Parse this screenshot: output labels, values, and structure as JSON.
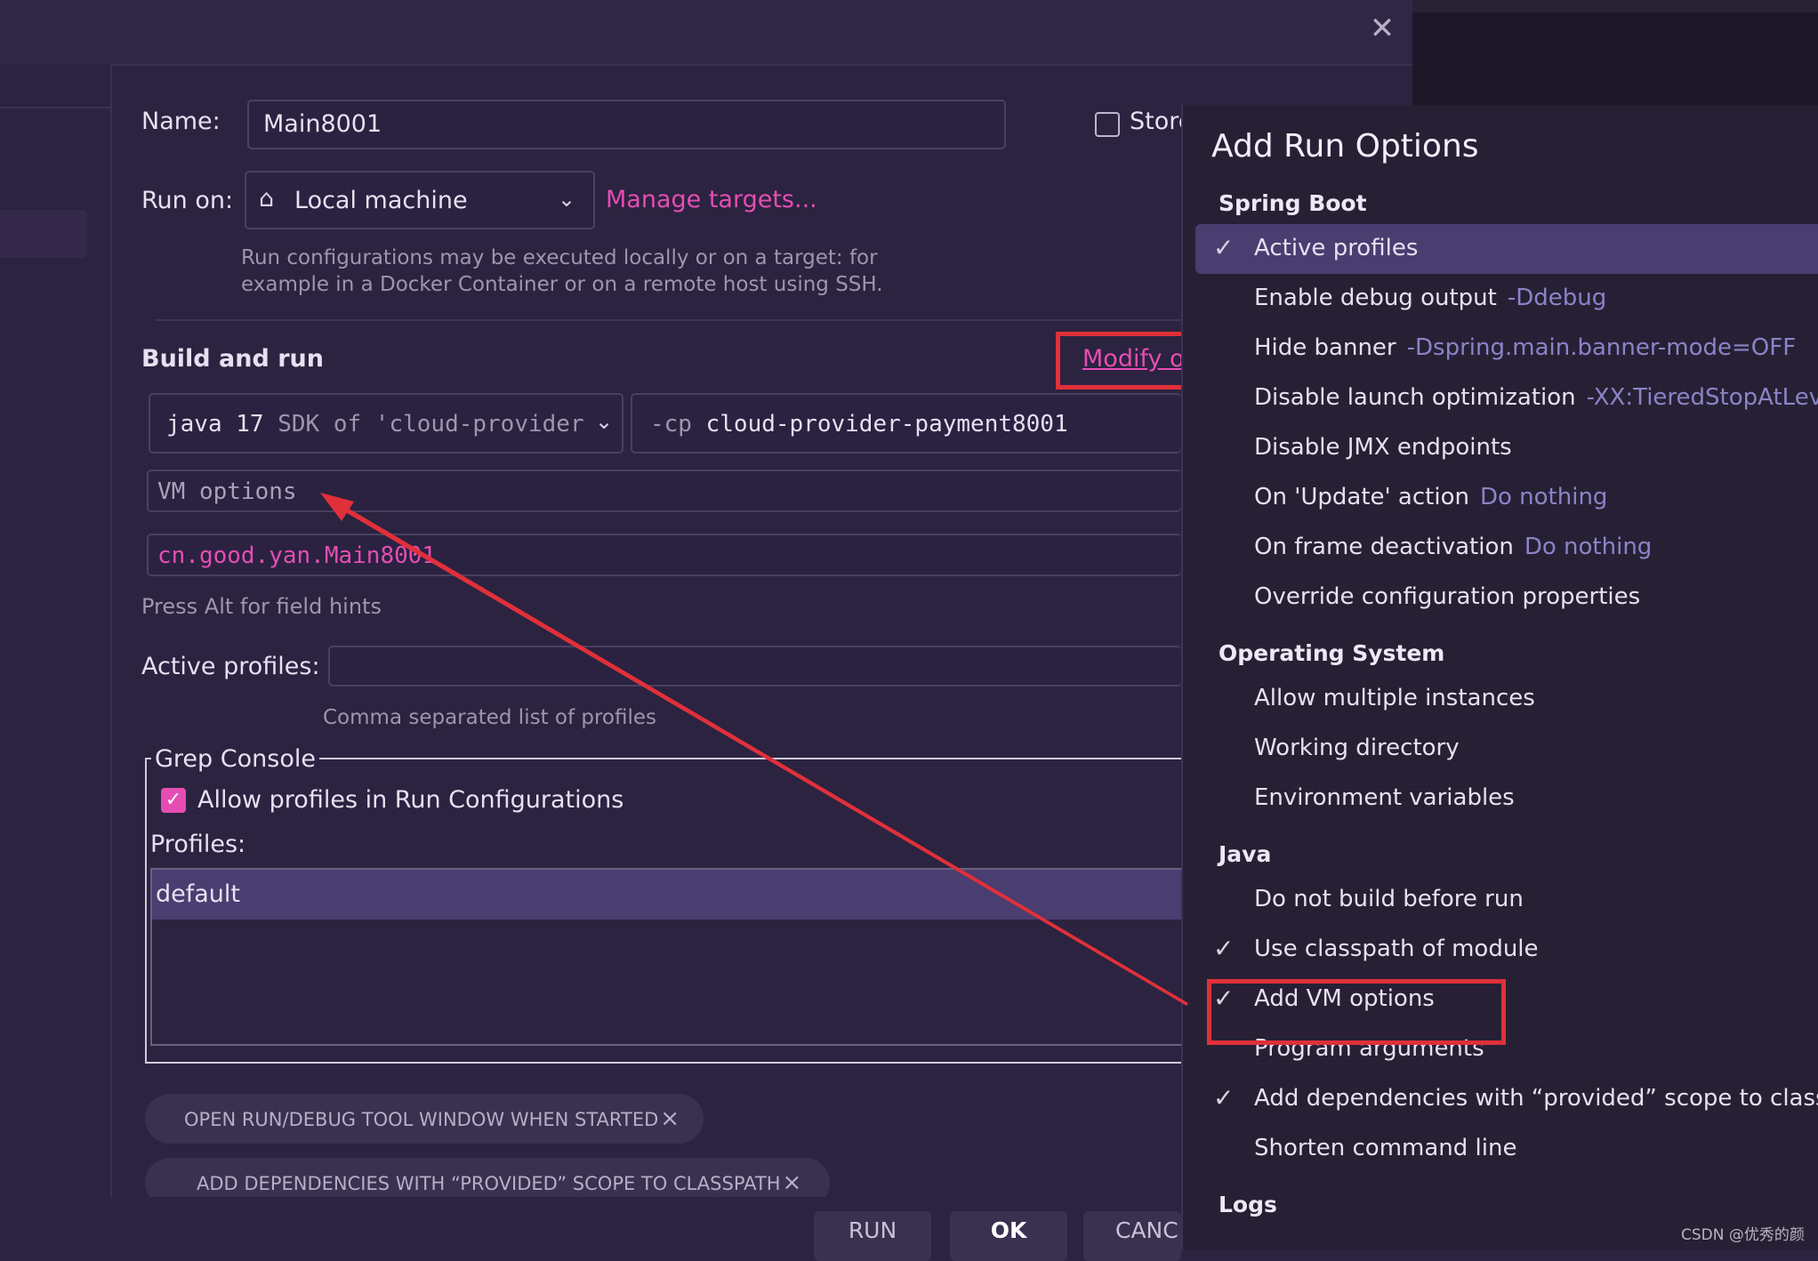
{
  "dialog": {
    "close_icon": "close-icon",
    "name_label": "Name:",
    "name_value": "Main8001",
    "store_label": "Store",
    "run_on_label": "Run on:",
    "run_on_value": "Local machine",
    "manage_targets": "Manage targets...",
    "run_on_hint_1": "Run configurations may be executed locally or on a target: for",
    "run_on_hint_2": "example in a Docker Container or on a remote host using SSH.",
    "build_and_run": "Build and run",
    "modify_options": "Modify op",
    "sdk_java": "java 17",
    "sdk_rest": " SDK of 'cloud-provider",
    "cp_prefix": "-cp",
    "cp_value": "cloud-provider-payment8001",
    "vm_options_placeholder": "VM options",
    "main_class": "cn.good.yan.Main8001",
    "field_hints": "Press Alt for field hints",
    "active_profiles_label": "Active profiles:",
    "active_profiles_value": "",
    "active_profiles_hint": "Comma separated list of profiles",
    "grep_console_title": "Grep Console",
    "allow_profiles_label": "Allow profiles in Run Configurations",
    "allow_profiles_checked": true,
    "profiles_label": "Profiles:",
    "profiles": [
      "default"
    ],
    "pill_open_tool_window": "OPEN RUN/DEBUG TOOL WINDOW WHEN STARTED",
    "pill_add_dependencies": "ADD DEPENDENCIES WITH “PROVIDED” SCOPE TO CLASSPATH",
    "pill_close_glyph": "×",
    "buttons": {
      "run": "RUN",
      "ok": "OK",
      "cancel": "CANC"
    }
  },
  "popup": {
    "title": "Add Run Options",
    "sections": [
      {
        "title": "Spring Boot",
        "items": [
          {
            "label": "Active profiles",
            "checked": true,
            "selected": true
          },
          {
            "label": "Enable debug output",
            "sub": "-Ddebug"
          },
          {
            "label": "Hide banner",
            "sub": "-Dspring.main.banner-mode=OFF"
          },
          {
            "label": "Disable launch optimization",
            "sub": "-XX:TieredStopAtLevel"
          },
          {
            "label": "Disable JMX endpoints"
          },
          {
            "label": "On 'Update' action",
            "sub": "Do nothing"
          },
          {
            "label": "On frame deactivation",
            "sub": "Do nothing"
          },
          {
            "label": "Override configuration properties"
          }
        ]
      },
      {
        "title": "Operating System",
        "items": [
          {
            "label": "Allow multiple instances"
          },
          {
            "label": "Working directory"
          },
          {
            "label": "Environment variables"
          }
        ]
      },
      {
        "title": "Java",
        "items": [
          {
            "label": "Do not build before run"
          },
          {
            "label": "Use classpath of module",
            "checked": true
          },
          {
            "label": "Add VM options",
            "checked": true
          },
          {
            "label": "Program arguments"
          },
          {
            "label": "Add dependencies with “provided” scope to classpa",
            "checked": true
          },
          {
            "label": "Shorten command line"
          }
        ]
      },
      {
        "title": "Logs",
        "items": []
      }
    ]
  },
  "watermark": "CSDN @优秀的颜",
  "colors": {
    "accent": "#e64db3",
    "annotation_red": "#e0303a",
    "selection": "#4a3d70",
    "sub_text": "#8a84c7"
  }
}
